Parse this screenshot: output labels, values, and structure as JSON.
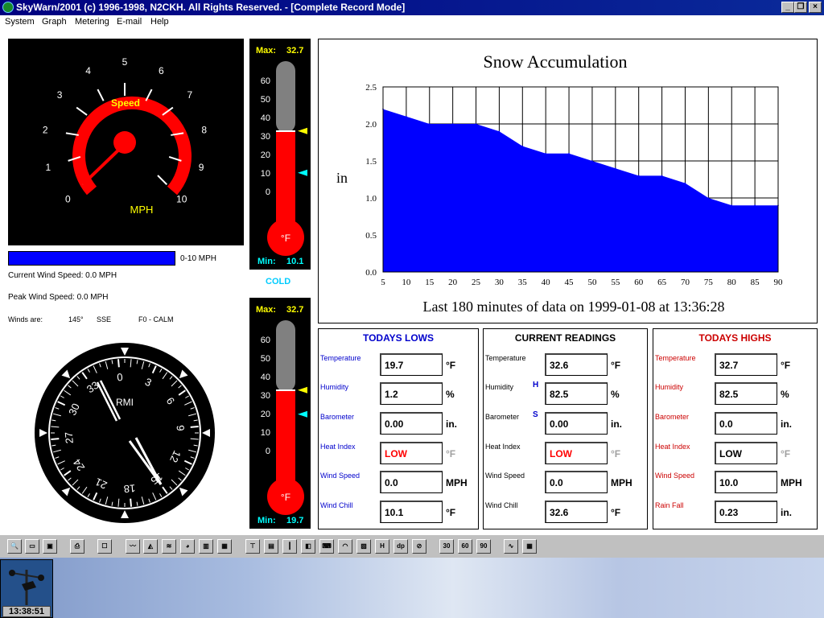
{
  "window": {
    "title": "SkyWarn/2001 (c) 1996-1998, N2CKH. All Rights Reserved. - [Complete Record Mode]",
    "minimize": "_",
    "restore": "❐",
    "close": "×"
  },
  "menu": [
    {
      "label": "System",
      "underline": "S"
    },
    {
      "label": "Graph",
      "underline": "G"
    },
    {
      "label": "Metering",
      "underline": "M"
    },
    {
      "label": "E-mail",
      "underline": "E"
    },
    {
      "label": "Help",
      "underline": "H"
    }
  ],
  "speed_gauge": {
    "title": "Speed",
    "unit": "MPH",
    "ticks": [
      "0",
      "1",
      "2",
      "3",
      "4",
      "5",
      "6",
      "7",
      "8",
      "9",
      "10"
    ],
    "value": 0
  },
  "speed_bar": {
    "range_label": "0-10 MPH"
  },
  "wind_info": {
    "current": "Current  Wind Speed: 0.0 MPH",
    "peak": "Peak Wind Speed: 0.0 MPH",
    "winds_are_label": "Winds are:",
    "direction_deg": "145°",
    "direction_cardinal": "SSE",
    "force": "F0 - CALM"
  },
  "thermo_outdoor": {
    "max_label": "Max:",
    "max_value": "32.7",
    "min_label": "Min:",
    "min_value": "10.1",
    "unit": "°F",
    "scale": [
      "60",
      "50",
      "40",
      "30",
      "20",
      "10",
      "0"
    ],
    "current": 32.6,
    "max": 32.7,
    "min": 10.1,
    "caption": "COLD"
  },
  "thermo_indoor": {
    "max_label": "Max:",
    "max_value": "32.7",
    "min_label": "Min:",
    "min_value": "19.7",
    "unit": "°F",
    "scale": [
      "60",
      "50",
      "40",
      "30",
      "20",
      "10",
      "0"
    ],
    "current": 32.6,
    "max": 32.7,
    "min": 19.7
  },
  "rmi": {
    "label": "RMI",
    "heading_labels": [
      "0",
      "3",
      "6",
      "9",
      "12",
      "15",
      "18",
      "21",
      "24",
      "27",
      "30",
      "33"
    ]
  },
  "chart_data": {
    "type": "area",
    "title": "Snow Accumulation",
    "ylabel": "in",
    "xlabel": "Last 180 minutes of data on 1999-01-08 at 13:36:28",
    "x": [
      5,
      10,
      15,
      20,
      25,
      30,
      35,
      40,
      45,
      50,
      55,
      60,
      65,
      70,
      75,
      80,
      85,
      90
    ],
    "values": [
      2.2,
      2.1,
      2.0,
      2.0,
      2.0,
      1.9,
      1.7,
      1.6,
      1.6,
      1.5,
      1.4,
      1.3,
      1.3,
      1.2,
      1.0,
      0.9,
      0.9,
      0.9
    ],
    "xlim": [
      5,
      90
    ],
    "ylim": [
      0,
      2.5
    ],
    "yticks": [
      "0.0",
      "0.5",
      "1.0",
      "1.5",
      "2.0",
      "2.5"
    ],
    "xticks": [
      "5",
      "10",
      "15",
      "20",
      "25",
      "30",
      "35",
      "40",
      "45",
      "50",
      "55",
      "60",
      "65",
      "70",
      "75",
      "80",
      "85",
      "90"
    ],
    "grid": true,
    "color": "#0000ff"
  },
  "readings": {
    "lows": {
      "title": "TODAYS LOWS",
      "color": "#0000cc",
      "rows": [
        {
          "label": "Temperature",
          "value": "19.7",
          "unit": "°F"
        },
        {
          "label": "Humidity",
          "value": "1.2",
          "unit": "%"
        },
        {
          "label": "Barometer",
          "value": "0.00",
          "unit": "in."
        },
        {
          "label": "Heat Index",
          "value": "LOW",
          "unit": "°F"
        },
        {
          "label": "Wind Speed",
          "value": "0.0",
          "unit": "MPH"
        },
        {
          "label": "Wind Chill",
          "value": "10.1",
          "unit": "°F"
        }
      ]
    },
    "current": {
      "title": "CURRENT READINGS",
      "color": "#000000",
      "rows": [
        {
          "label": "Temperature",
          "value": "32.6",
          "unit": "°F"
        },
        {
          "label": "Humidity",
          "value": "82.5",
          "unit": "%"
        },
        {
          "label": "Barometer",
          "value": "0.00",
          "unit": "in."
        },
        {
          "label": "Heat Index",
          "value": "LOW",
          "unit": "°F"
        },
        {
          "label": "Wind Speed",
          "value": "0.0",
          "unit": "MPH"
        },
        {
          "label": "Wind Chill",
          "value": "32.6",
          "unit": "°F"
        }
      ],
      "markers": {
        "humidity": "H",
        "barometer": "S"
      }
    },
    "highs": {
      "title": "TODAYS HIGHS",
      "color": "#cc0000",
      "rows": [
        {
          "label": "Temperature",
          "value": "32.7",
          "unit": "°F"
        },
        {
          "label": "Humidity",
          "value": "82.5",
          "unit": "%"
        },
        {
          "label": "Barometer",
          "value": "0.0",
          "unit": "in."
        },
        {
          "label": "Heat Index",
          "value": "LOW",
          "unit": "°F"
        },
        {
          "label": "Wind Speed",
          "value": "10.0",
          "unit": "MPH"
        },
        {
          "label": "Rain Fall",
          "value": "0.23",
          "unit": "in."
        }
      ]
    }
  },
  "toolbar": {
    "range_buttons": [
      "30",
      "60",
      "90"
    ]
  },
  "status": {
    "clock": "13:38:51"
  }
}
